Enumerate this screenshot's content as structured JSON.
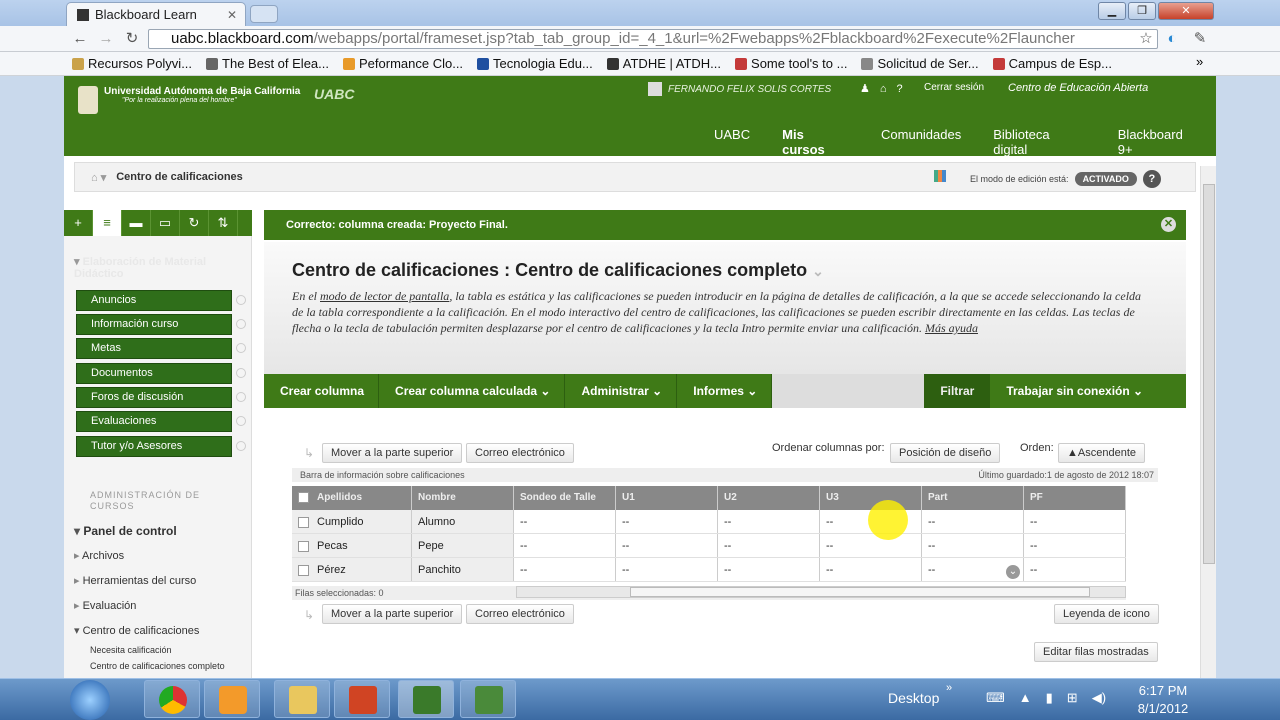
{
  "browser": {
    "tab_title": "Blackboard Learn",
    "url_host": "uabc.blackboard.com",
    "url_path": "/webapps/portal/frameset.jsp?tab_tab_group_id=_4_1&url=%2Fwebapps%2Fblackboard%2Fexecute%2Flauncher",
    "bookmarks": [
      "Recursos Polyvi...",
      "The Best of Elea...",
      "Peformance Clo...",
      "Tecnologia Edu...",
      "ATDHE | ATDH...",
      "Some tool's to ...",
      "Solicitud de Ser...",
      "Campus de Esp..."
    ],
    "bookmark_colors": [
      "#caa24a",
      "#666666",
      "#e89a2a",
      "#1f4fa0",
      "#333333",
      "#c43a3a",
      "#888888",
      "#c43a3a"
    ],
    "more": "»"
  },
  "header": {
    "university": "Universidad Autónoma de Baja California",
    "motto": "\"Por la realización plena del hombre\"",
    "uabc": "UABC",
    "user": "FERNANDO FELIX SOLIS CORTES",
    "signout": "Cerrar sesión",
    "center": "Centro de Educación Abierta",
    "nav": [
      "UABC",
      "Mis cursos",
      "Comunidades",
      "Biblioteca digital",
      "Blackboard 9+"
    ]
  },
  "breadcrumb": "Centro de calificaciones",
  "edit_mode": {
    "label": "El modo de edición está:",
    "state": "ACTIVADO",
    "help": "?"
  },
  "left": {
    "tools": [
      "+",
      "≡",
      "▬",
      "▭",
      "↻",
      "⇅"
    ],
    "course_title": "Elaboración de Material Didáctico",
    "menu": [
      "Anuncios",
      "Información curso",
      "Metas",
      "Documentos",
      "Foros de discusión",
      "Evaluaciones",
      "Tutor y/o Asesores"
    ],
    "admin_heading": "ADMINISTRACIÓN DE CURSOS",
    "control_panel": "Panel de control",
    "cp_items": [
      "Archivos",
      "Herramientas del curso",
      "Evaluación",
      "Centro de calificaciones"
    ],
    "sub_items": [
      "Necesita calificación",
      "Centro de calificaciones completo"
    ]
  },
  "success": "Correcto: columna creada: Proyecto Final.",
  "page": {
    "title": "Centro de calificaciones : Centro de calificaciones completo",
    "description_a": "En el ",
    "description_link": "modo de lector de pantalla",
    "description_b": ", la tabla es estática y las calificaciones se pueden introducir en la página de detalles de calificación, a la que se accede seleccionando la celda de la tabla correspondiente a la calificación. En el modo interactivo del centro de calificaciones, las calificaciones se pueden escribir directamente en las celdas. Las teclas de flecha o la tecla de tabulación permiten desplazarse por el centro de calificaciones y la tecla Intro permite enviar una calificación. ",
    "help_link": "Más ayuda"
  },
  "actions": [
    "Crear columna",
    "Crear columna calculada",
    "Administrar",
    "Informes"
  ],
  "filter": "Filtrar",
  "offline": "Trabajar sin conexión",
  "grid_controls": {
    "move_top": "Mover a la parte superior",
    "email": "Correo electrónico",
    "order_label": "Ordenar columnas por:",
    "order_value": "Posición de diseño",
    "order2_label": "Orden:",
    "order2_value": "▲Ascendente",
    "info_bar": "Barra de información sobre calificaciones",
    "last_saved": "Último guardado:1 de agosto de 2012 18:07",
    "selected": "Filas seleccionadas: 0",
    "icon_legend": "Leyenda de icono",
    "edit_rows": "Editar filas mostradas"
  },
  "grid": {
    "columns": [
      "Apellidos",
      "Nombre",
      "Sondeo de Talle",
      "U1",
      "U2",
      "U3",
      "Part",
      "PF"
    ],
    "rows": [
      [
        "Cumplido",
        "Alumno",
        "--",
        "--",
        "--",
        "--",
        "--",
        "--"
      ],
      [
        "Pecas",
        "Pepe",
        "--",
        "--",
        "--",
        "--",
        "--",
        "--"
      ],
      [
        "Pérez",
        "Panchito",
        "--",
        "--",
        "--",
        "--",
        "--",
        "--"
      ]
    ]
  },
  "taskbar": {
    "desktop": "Desktop",
    "time": "6:17 PM",
    "date": "8/1/2012"
  }
}
